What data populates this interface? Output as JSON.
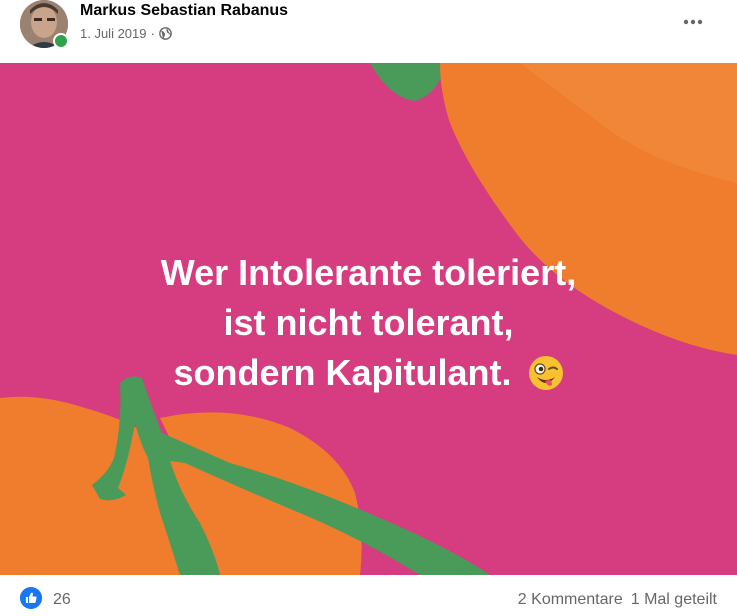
{
  "post": {
    "author": "Markus Sebastian Rabanus",
    "date": "1. Juli 2019",
    "separator": "·",
    "audience_icon": "globe-icon",
    "more_icon": "ellipsis-icon",
    "online": true
  },
  "image": {
    "quote_lines": [
      "Wer Intolerante toleriert,",
      "ist nicht tolerant,",
      "sondern Kapitulant."
    ],
    "emoji": "winking-face-with-tongue-emoji",
    "background_color": "#d63c80",
    "fruit_color": "#f07c2e",
    "leaf_color": "#4a9a5a"
  },
  "reactions": {
    "icon": "like-icon",
    "count": "26",
    "comments": "2 Kommentare",
    "shares": "1 Mal geteilt"
  }
}
